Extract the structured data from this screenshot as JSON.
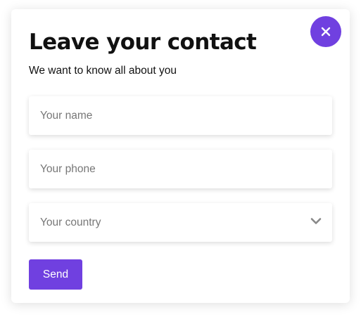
{
  "modal": {
    "title": "Leave your contact",
    "subtitle": "We want to know all about you",
    "close_icon": "close-icon",
    "fields": {
      "name": {
        "placeholder": "Your name",
        "value": ""
      },
      "phone": {
        "placeholder": "Your phone",
        "value": ""
      },
      "country": {
        "placeholder": "Your country",
        "selected": "",
        "icon": "chevron-down-icon"
      }
    },
    "send_label": "Send"
  },
  "colors": {
    "accent": "#7040e0",
    "text": "#111111",
    "placeholder": "#777777",
    "chevron": "#888888"
  }
}
